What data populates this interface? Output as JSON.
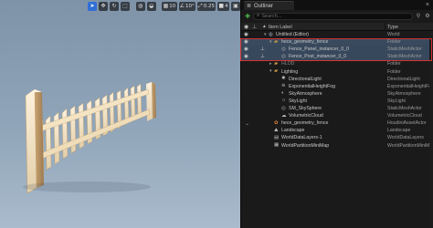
{
  "viewport": {
    "toolbar": {
      "grid_snap_value": "10",
      "rotation_snap_value": "10°",
      "scale_snap_value": "0.25",
      "camera_speed_value": "4"
    }
  },
  "outliner": {
    "tab_title": "Outliner",
    "search_placeholder": "Search...",
    "header": {
      "label": "Item Label",
      "type": "Type"
    },
    "rows": [
      {
        "label": "Untitled (Editor)",
        "type": "World"
      },
      {
        "label": "hece_geometry_fence",
        "type": "Folder"
      },
      {
        "label": "Fence_Panel_instancer_0_0",
        "type": "StaticMeshActor"
      },
      {
        "label": "Fence_Post_instancer_0_0",
        "type": "StaticMeshActor"
      },
      {
        "label": "HLOD",
        "type": "Folder"
      },
      {
        "label": "Lighting",
        "type": "Folder"
      },
      {
        "label": "DirectionalLight",
        "type": "DirectionalLight"
      },
      {
        "label": "ExponentialHeightFog",
        "type": "ExponentialHeightFo"
      },
      {
        "label": "SkyAtmosphere",
        "type": "SkyAtmosphere"
      },
      {
        "label": "SkyLight",
        "type": "SkyLight"
      },
      {
        "label": "SM_SkySphere",
        "type": "StaticMeshActor"
      },
      {
        "label": "VolumetricCloud",
        "type": "VolumetricCloud"
      },
      {
        "label": "hece_geometry_fence",
        "type": "HoudiniAssetActor"
      },
      {
        "label": "Landscape",
        "type": "Landscape"
      },
      {
        "label": "WorldDataLayers-1",
        "type": "WorldDataLayers"
      },
      {
        "label": "WorldPartitionMiniMap",
        "type": "WorldPartitionMiniMa"
      }
    ]
  },
  "colors": {
    "selection_row": "#38485c",
    "selection_box": "#d13232",
    "folder": "#c79a45",
    "active_toolbar_button": "#2f6fd6"
  }
}
